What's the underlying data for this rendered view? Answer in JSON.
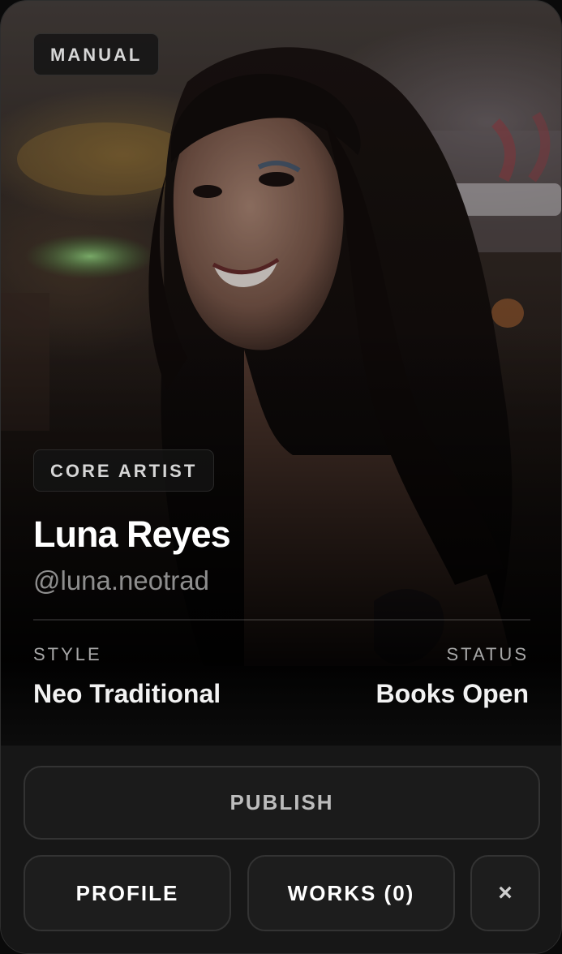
{
  "card": {
    "source_badge": "MANUAL",
    "role_badge": "CORE ARTIST",
    "name": "Luna Reyes",
    "handle": "@luna.neotrad",
    "style": {
      "label": "STYLE",
      "value": "Neo Traditional"
    },
    "status": {
      "label": "STATUS",
      "value": "Books Open"
    }
  },
  "actions": {
    "publish_label": "PUBLISH",
    "profile_label": "PROFILE",
    "works_label": "WORKS (0)",
    "close_label": "×"
  },
  "icons": {
    "close": "close-icon"
  },
  "colors": {
    "card_background": "#161616",
    "button_background": "#1d1d1d",
    "button_border": "#333333",
    "name_text": "#ffffff",
    "handle_text": "#8e8e8e"
  }
}
